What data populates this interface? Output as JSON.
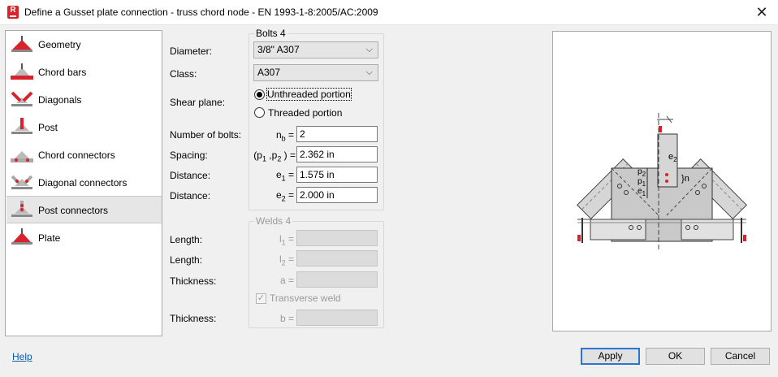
{
  "window": {
    "title": "Define a Gusset plate connection - truss chord node - EN 1993-1-8:2005/AC:2009",
    "app_icon_letter": "R"
  },
  "sidebar": {
    "items": [
      {
        "label": "Geometry",
        "icon": "geometry-icon"
      },
      {
        "label": "Chord bars",
        "icon": "chord-bars-icon"
      },
      {
        "label": "Diagonals",
        "icon": "diagonals-icon"
      },
      {
        "label": "Post",
        "icon": "post-icon"
      },
      {
        "label": "Chord connectors",
        "icon": "chord-connectors-icon"
      },
      {
        "label": "Diagonal connectors",
        "icon": "diagonal-connectors-icon"
      },
      {
        "label": "Post connectors",
        "icon": "post-connectors-icon",
        "selected": true
      },
      {
        "label": "Plate",
        "icon": "plate-icon"
      }
    ]
  },
  "bolts": {
    "group_title": "Bolts 4",
    "diameter_label": "Diameter:",
    "diameter_value": "3/8\" A307",
    "class_label": "Class:",
    "class_value": "A307",
    "shear_plane_label": "Shear plane:",
    "shear_options": [
      "Unthreaded portion",
      "Threaded portion"
    ],
    "shear_selected": "Unthreaded portion",
    "num_bolts_label": "Number of bolts:",
    "num_bolts_sym": "n",
    "num_bolts_sub": "b",
    "num_bolts_value": "2",
    "spacing_label": "Spacing:",
    "spacing_value": "2.362 in",
    "distance1_label": "Distance:",
    "distance1_sym": "e",
    "distance1_sub": "1",
    "distance1_value": "1.575 in",
    "distance2_label": "Distance:",
    "distance2_sym": "e",
    "distance2_sub": "2",
    "distance2_value": "2.000 in"
  },
  "welds": {
    "group_title": "Welds 4",
    "length1_label": "Length:",
    "length1_sym": "l",
    "length1_sub": "1",
    "length2_label": "Length:",
    "length2_sym": "l",
    "length2_sub": "2",
    "thickness1_label": "Thickness:",
    "thickness1_sym": "a",
    "transverse_label": "Transverse weld",
    "transverse_checked": true,
    "thickness2_label": "Thickness:",
    "thickness2_sym": "b"
  },
  "preview": {
    "labels": {
      "e2": "e",
      "e2_sub": "2",
      "p2": "p",
      "p2_sub": "2",
      "p1": "p",
      "p1_sub": "1",
      "e1": "e",
      "e1_sub": "1",
      "n": "n"
    }
  },
  "footer": {
    "help_label": "Help",
    "apply_label": "Apply",
    "ok_label": "OK",
    "cancel_label": "Cancel"
  },
  "colors": {
    "accent": "#d8232a",
    "link": "#0b5cad",
    "default_button_border": "#2a74d4"
  }
}
